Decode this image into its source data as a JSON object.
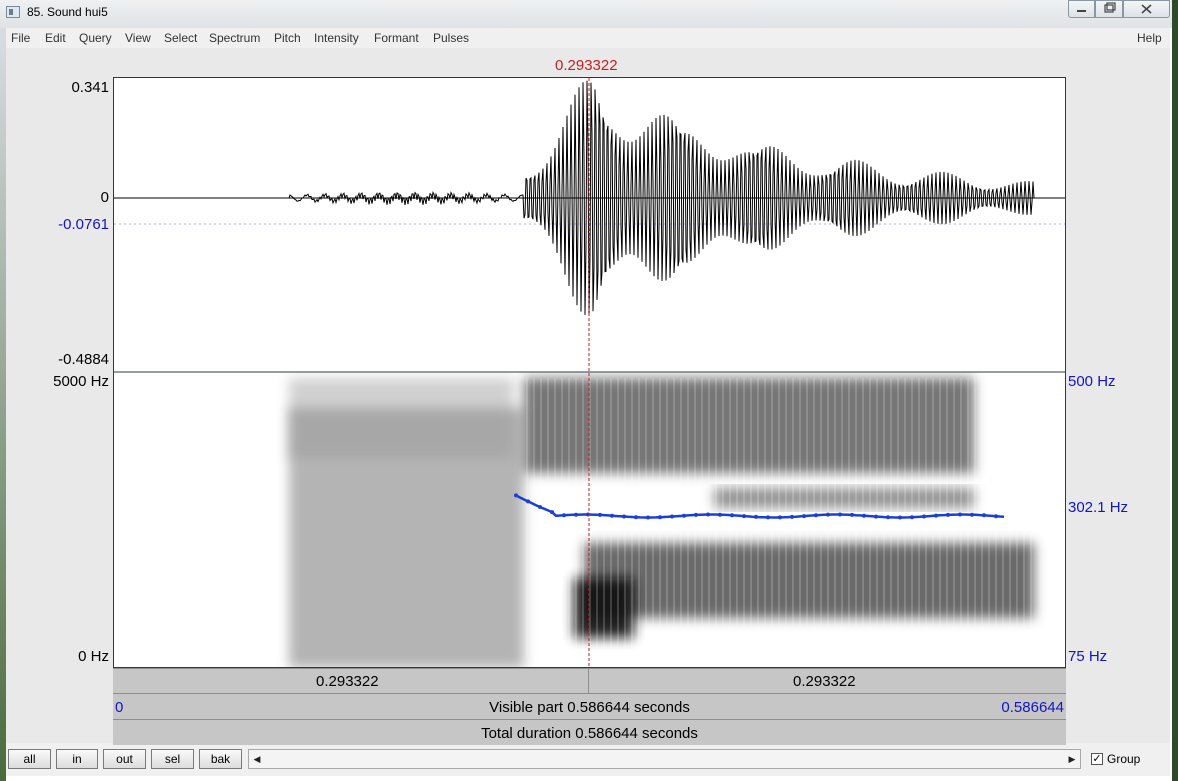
{
  "window": {
    "title": "85. Sound hui5"
  },
  "menu": {
    "items": [
      "File",
      "Edit",
      "Query",
      "View",
      "Select",
      "Spectrum",
      "Pitch",
      "Intensity",
      "Formant",
      "Pulses"
    ],
    "help": "Help"
  },
  "cursor": {
    "time": "0.293322",
    "color": "#c81e1e"
  },
  "waveform": {
    "ymax": "0.341",
    "zero": "0",
    "cursor_value": "-0.0761",
    "ymin": "-0.4884"
  },
  "spectrogram": {
    "freq_max": "5000 Hz",
    "freq_min": "0 Hz"
  },
  "pitch": {
    "max": "500 Hz",
    "cursor": "302.1 Hz",
    "min": "75 Hz",
    "color": "#1a3fd6"
  },
  "time_bar": {
    "left": "0.293322",
    "right": "0.293322"
  },
  "visible": {
    "start": "0",
    "label": "Visible part 0.586644 seconds",
    "end": "0.586644"
  },
  "total": {
    "label": "Total duration 0.586644 seconds"
  },
  "buttons": {
    "all": "all",
    "in": "in",
    "out": "out",
    "sel": "sel",
    "bak": "bak"
  },
  "group": {
    "label": "Group",
    "checked": true,
    "mark": "✓"
  }
}
